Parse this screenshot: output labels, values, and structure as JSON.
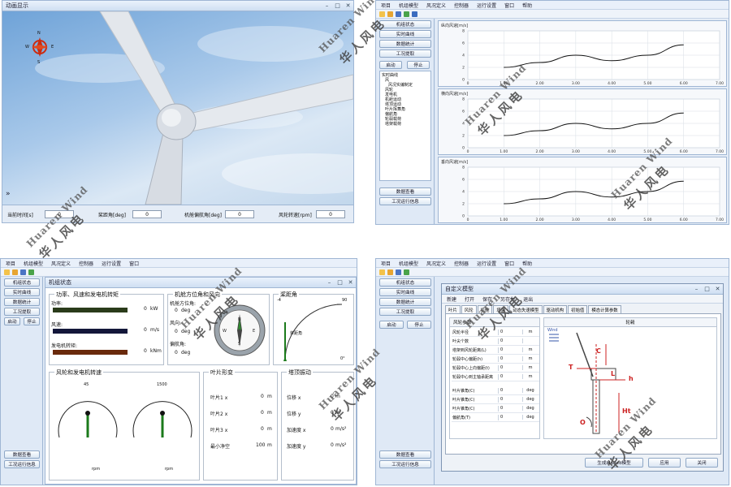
{
  "q1": {
    "title": "动画显示",
    "compass": {
      "n": "N",
      "s": "S",
      "e": "E",
      "w": "W"
    },
    "expand": "»",
    "fields": [
      {
        "label": "当前时间[s]",
        "value": "0"
      },
      {
        "label": "桨距角[deg]",
        "value": "0"
      },
      {
        "label": "机舱偏航角[deg]",
        "value": "0"
      },
      {
        "label": "风轮转速[rpm]",
        "value": "0"
      }
    ]
  },
  "q2": {
    "menu": [
      "项目",
      "机组模型",
      "风况定义",
      "控制器",
      "运行设置",
      "窗口",
      "帮助"
    ],
    "buttons": [
      "机组状态",
      "实时曲线",
      "数据统计",
      "工况提取"
    ],
    "start": "启动",
    "stop": "停止",
    "tree": [
      "实时曲线",
      "风",
      "风况实编制定",
      "风轮",
      "发电机",
      "机舱运动",
      "塔顶运动",
      "叶片挥舞角",
      "偏航角",
      "轮毂载荷",
      "塔架载荷"
    ],
    "bottom_buttons": [
      "数据查看",
      "工况运行信息"
    ],
    "charts": [
      {
        "title": "纵向风速[m/s]"
      },
      {
        "title": "横向风速[m/s]"
      },
      {
        "title": "垂向风速[m/s]"
      }
    ]
  },
  "q3": {
    "menu": [
      "项目",
      "机组模型",
      "风况定义",
      "控制器",
      "运行设置",
      "窗口",
      "帮助"
    ],
    "buttons": [
      "机组状态",
      "实时曲线",
      "数据统计",
      "工况提取"
    ],
    "start": "启动",
    "stop": "停止",
    "bottom_buttons": [
      "数据查看",
      "工况运行信息"
    ],
    "window_title": "机组状态",
    "power": {
      "title": "功率、风速和发电机转矩",
      "rows": [
        {
          "label": "功率:",
          "value": "0",
          "unit": "kW"
        },
        {
          "label": "风速:",
          "value": "0",
          "unit": "m/s"
        },
        {
          "label": "发电机转矩:",
          "value": "0",
          "unit": "kNm"
        }
      ]
    },
    "nacelle": {
      "title": "机舱方位角和风向",
      "rows": [
        {
          "label": "机舱方位角:",
          "value": "0",
          "unit": "deg"
        },
        {
          "label": "风向:",
          "value": "0",
          "unit": "deg"
        },
        {
          "label": "偏航角:",
          "value": "0",
          "unit": "deg"
        }
      ]
    },
    "pitch": {
      "title": "桨距角",
      "lo": "-4",
      "hi": "90",
      "unit": "0°",
      "label": "桨距角"
    },
    "rotor": {
      "title": "风轮和发电机转速",
      "g1_max": "45",
      "g2_max": "1500",
      "g1_unit": "rpm",
      "g2_unit": "rpm"
    },
    "blade": {
      "title": "叶片形变",
      "rows": [
        {
          "label": "叶片1 x",
          "value": "0",
          "unit": "m"
        },
        {
          "label": "叶片2 x",
          "value": "0",
          "unit": "m"
        },
        {
          "label": "叶片3 x",
          "value": "0",
          "unit": "m"
        },
        {
          "label": "最小净空",
          "value": "100",
          "unit": "m"
        }
      ]
    },
    "tower": {
      "title": "塔顶振动",
      "rows": [
        {
          "label": "位移 x",
          "value": "0",
          "unit": "m"
        },
        {
          "label": "位移 y",
          "value": "0",
          "unit": "m"
        },
        {
          "label": "加速度 x",
          "value": "0",
          "unit": "m/s²"
        },
        {
          "label": "加速度 y",
          "value": "0",
          "unit": "m/s²"
        }
      ]
    }
  },
  "q4": {
    "menu": [
      "项目",
      "机组模型",
      "风况定义",
      "控制器",
      "运行设置",
      "窗口",
      "帮助"
    ],
    "buttons": [
      "机组状态",
      "实时曲线",
      "数据统计",
      "工况提取"
    ],
    "start": "启动",
    "stop": "停止",
    "bottom_buttons": [
      "数据查看",
      "工况运行信息"
    ],
    "dialog_title": "自定义模型",
    "dialog_menu": [
      "新建",
      "打开",
      "保存",
      "另存为",
      "退出"
    ],
    "tabs": [
      "叶片",
      "风轮",
      "机舱",
      "塔架",
      "动态失速模型",
      "驱动机构",
      "初始值",
      "模态计算参数"
    ],
    "subtab": "风轮参数",
    "image_title": "轮毂",
    "params": [
      {
        "label": "风轮半径",
        "value": "0",
        "unit": "m"
      },
      {
        "label": "叶尖个数",
        "value": "0",
        "unit": ""
      },
      {
        "label": "塔架到风轮距离(L)",
        "value": "0",
        "unit": "m"
      },
      {
        "label": "轮毂中心偏距(h)",
        "value": "0",
        "unit": "m"
      },
      {
        "label": "轮毂中心上向偏距(t)",
        "value": "0",
        "unit": "m"
      },
      {
        "label": "轮毂中心到主轴承距离",
        "value": "0",
        "unit": "m"
      },
      {
        "label": "叶片锥角(C)",
        "value": "0",
        "unit": "deg"
      },
      {
        "label": "叶片锥角(C)",
        "value": "0",
        "unit": "deg"
      },
      {
        "label": "叶片锥角(C)",
        "value": "0",
        "unit": "deg"
      },
      {
        "label": "偏航角(T)",
        "value": "0",
        "unit": "deg"
      }
    ],
    "diagram_labels": {
      "wind": "Wind",
      "t": "T",
      "c": "C",
      "l": "L",
      "h": "h",
      "ht": "Ht",
      "o": "O"
    },
    "footer_buttons": [
      "生成bladed模型",
      "应用",
      "关闭"
    ]
  },
  "watermark": {
    "en": "Huaren Wind",
    "cn": "华人风电"
  },
  "chart_data": [
    {
      "type": "line",
      "title": "纵向风速[m/s]",
      "x": [
        1,
        2,
        3,
        4,
        5,
        6,
        7
      ],
      "series": [
        {
          "values": [
            2,
            2.8,
            4,
            3.1,
            4,
            5.7,
            null
          ]
        }
      ],
      "xlim": [
        0,
        7
      ],
      "ylim": [
        0,
        8
      ],
      "xticks": [
        "0",
        "1.00",
        "2.00",
        "3.00",
        "4.00",
        "5.00",
        "6.00",
        "7.00"
      ],
      "yticks": [
        "0",
        "2",
        "4",
        "6",
        "8"
      ]
    },
    {
      "type": "line",
      "title": "横向风速[m/s]",
      "x": [
        1,
        2,
        3,
        4,
        5,
        6,
        7
      ],
      "series": [
        {
          "values": [
            2,
            2.8,
            4,
            3.1,
            4,
            5.7,
            null
          ]
        }
      ],
      "xlim": [
        0,
        7
      ],
      "ylim": [
        0,
        8
      ],
      "xticks": [
        "0",
        "1.00",
        "2.00",
        "3.00",
        "4.00",
        "5.00",
        "6.00",
        "7.00"
      ],
      "yticks": [
        "0",
        "2",
        "4",
        "6",
        "8"
      ]
    },
    {
      "type": "line",
      "title": "垂向风速[m/s]",
      "x": [
        1,
        2,
        3,
        4,
        5,
        6,
        7
      ],
      "series": [
        {
          "values": [
            2,
            2.8,
            4,
            3.1,
            4,
            5.7,
            null
          ]
        }
      ],
      "xlim": [
        0,
        7
      ],
      "ylim": [
        0,
        8
      ],
      "xticks": [
        "0",
        "1.00",
        "2.00",
        "3.00",
        "4.00",
        "5.00",
        "6.00",
        "7.00"
      ],
      "yticks": [
        "0",
        "2",
        "4",
        "6",
        "8"
      ]
    }
  ],
  "colors": {
    "sky": "#8fb8e6",
    "panel": "#dfe9f6",
    "power_bar": "#2a3b1a",
    "wind_bar": "#13173a",
    "torque_bar": "#6a2a0c",
    "compass_red": "#cc2b10"
  }
}
